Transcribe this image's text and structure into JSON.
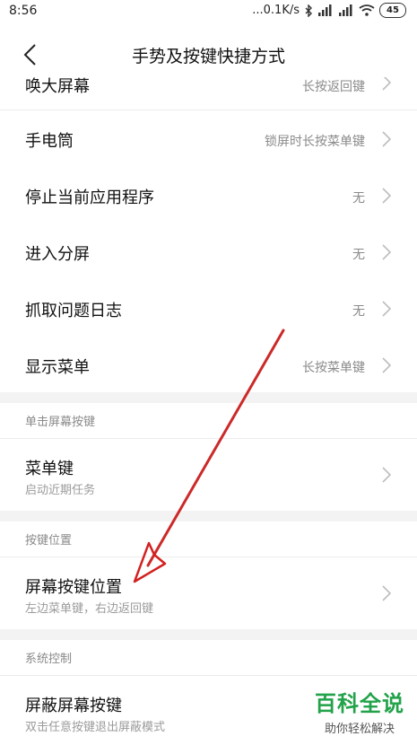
{
  "status_bar": {
    "time": "8:56",
    "network_speed": "...0.1K/s",
    "battery": "45"
  },
  "header": {
    "title": "手势及按键快捷方式"
  },
  "top_rows": [
    {
      "title": "唤大屏幕",
      "value": "长按返回键"
    },
    {
      "title": "手电筒",
      "value": "锁屏时长按菜单键"
    },
    {
      "title": "停止当前应用程序",
      "value": "无"
    },
    {
      "title": "进入分屏",
      "value": "无"
    },
    {
      "title": "抓取问题日志",
      "value": "无"
    },
    {
      "title": "显示菜单",
      "value": "长按菜单键"
    }
  ],
  "section_single": {
    "label": "单击屏幕按键",
    "item": {
      "title": "菜单键",
      "subtitle": "启动近期任务"
    }
  },
  "section_position": {
    "label": "按键位置",
    "item": {
      "title": "屏幕按键位置",
      "subtitle": "左边菜单键，右边返回键"
    }
  },
  "section_system": {
    "label": "系统控制",
    "item": {
      "title": "屏蔽屏幕按键",
      "subtitle": "双击任意按键退出屏蔽模式"
    }
  },
  "watermark": {
    "main": "百科全说",
    "sub": "助你轻松解决"
  },
  "colors": {
    "annotation_arrow": "#d32020",
    "watermark_green": "#22a24a",
    "section_bg": "#f3f3f3"
  }
}
